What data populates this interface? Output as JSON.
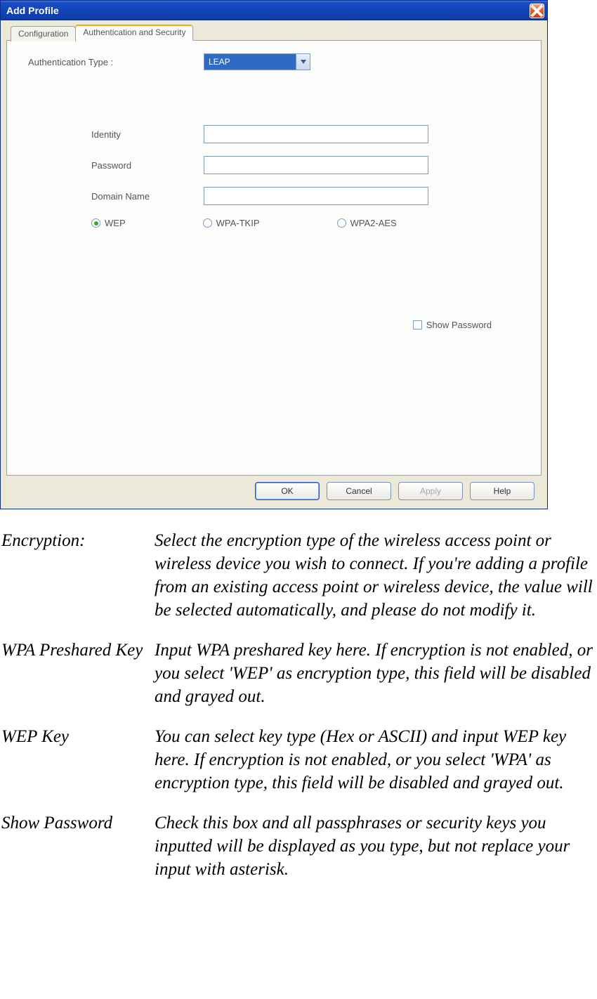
{
  "window": {
    "title": "Add Profile"
  },
  "tabs": {
    "configuration": "Configuration",
    "authsec": "Authentication and Security"
  },
  "form": {
    "auth_type_label": "Authentication Type :",
    "auth_type_value": "LEAP",
    "identity_label": "Identity",
    "identity_value": "",
    "password_label": "Password",
    "password_value": "",
    "domain_label": "Domain Name",
    "domain_value": "",
    "radio_wep": "WEP",
    "radio_tkip": "WPA-TKIP",
    "radio_aes": "WPA2-AES",
    "show_password": "Show Password"
  },
  "buttons": {
    "ok": "OK",
    "cancel": "Cancel",
    "apply": "Apply",
    "help": "Help"
  },
  "descriptions": [
    {
      "term": "Encryption:",
      "def": "Select the encryption type of the wireless access point or wireless device you wish to connect. If you're adding a profile from an existing access point or wireless device, the value will be selected automatically, and please do not modify it."
    },
    {
      "term": "WPA Preshared Key",
      "def": "Input WPA preshared key here. If encryption is not enabled, or you select 'WEP' as encryption type, this field will be disabled and grayed out."
    },
    {
      "term": "WEP Key",
      "def": "You can select key type (Hex or ASCII) and input WEP key here. If encryption is not enabled, or you select 'WPA' as encryption type, this field will be disabled and grayed out."
    },
    {
      "term": "Show Password",
      "def": "Check this box and all passphrases or security keys you inputted will be displayed as you type, but not replace your input with asterisk."
    }
  ]
}
